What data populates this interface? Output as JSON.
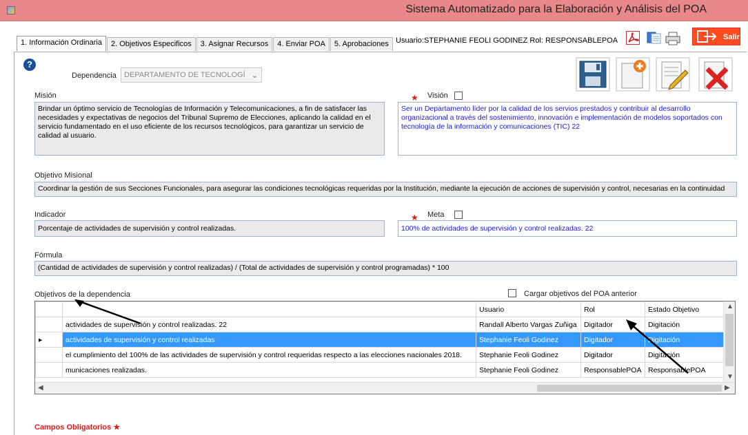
{
  "window": {
    "title": "Sistema Automatizado para la Elaboración y Análisis del POA"
  },
  "tabs": [
    {
      "label": "1. Información Ordinaria"
    },
    {
      "label": "2. Objetivos Especificos"
    },
    {
      "label": "3. Asignar Recursos"
    },
    {
      "label": "4. Enviar POA"
    },
    {
      "label": "5. Aprobaciones"
    }
  ],
  "user": {
    "info": "Usuario:STEPHANIE FEOLI GODINEZ  Rol: RESPONSABLEPOA"
  },
  "toolbar": {
    "exit_label": "Salir"
  },
  "form": {
    "dependencia_label": "Dependencia",
    "dependencia_value": "DEPARTAMENTO DE TECNOLOGÍ",
    "mision_label": "Misión",
    "mision_text": "Brindar un óptimo servicio de Tecnologías de Información y Telecomunicaciones, a fin de satisfacer las necesidades y expectativas de negocios del Tribunal Supremo de Elecciones, aplicando la calidad en el servicio fundamentado en el uso eficiente de los recursos tecnológicos, para garantizar un servicio de calidad al usuario.",
    "vision_label": "Visión",
    "vision_text": "Ser un Departamento líder por la calidad de los servios prestados y contribuir al desarrollo organizacional a través del sostenimiento, innovación e implementación de modelos soportados con tecnología de la información y comunicaciones (TIC) 22",
    "objetivo_label": "Objetivo Misional",
    "objetivo_text": "Coordinar la gestión de sus Secciones Funcionales, para asegurar las condiciones tecnológicas requeridas por la Institución, mediante la ejecución de acciones de supervisión y control, necesarias en la continuidad",
    "indicador_label": "Indicador",
    "indicador_text": "Porcentaje de actividades de supervisión y control realizadas.",
    "meta_label": "Meta",
    "meta_text": "100% de actividades de supervisión y control realizadas. 22",
    "formula_label": "Fórmula",
    "formula_text": "(Cantidad de actividades de supervisión y control realizadas) / (Total de actividades de supervisión y control programadas) * 100",
    "objetivos_dep_label": "Objetivos de la dependencia",
    "cargar_label": "Cargar objetivos del POA anterior",
    "required_label": "Campos Obligatorios"
  },
  "grid": {
    "columns": [
      "",
      "Usuario",
      "Rol",
      "Estado Objetivo"
    ],
    "rows": [
      {
        "desc": "actividades de supervisión y control realizadas. 22",
        "usuario": "Randall Alberto Vargas Zuñiga",
        "rol": "Digitador",
        "estado": "Digitación"
      },
      {
        "desc": "actividades de supervisión y control realizadas",
        "usuario": "Stephanie Feoli Godinez",
        "rol": "Digitador",
        "estado": "Digitación"
      },
      {
        "desc": "el cumplimiento del 100% de las actividades de supervisión y control requeridas respecto a las elecciones nacionales 2018.",
        "usuario": "Stephanie Feoli Godinez",
        "rol": "Digitador",
        "estado": "Digitación"
      },
      {
        "desc": "municaciones realizadas.",
        "usuario": "Stephanie Feoli Godinez",
        "rol": "ResponsablePOA",
        "estado": "ResponsablePOA"
      }
    ]
  }
}
